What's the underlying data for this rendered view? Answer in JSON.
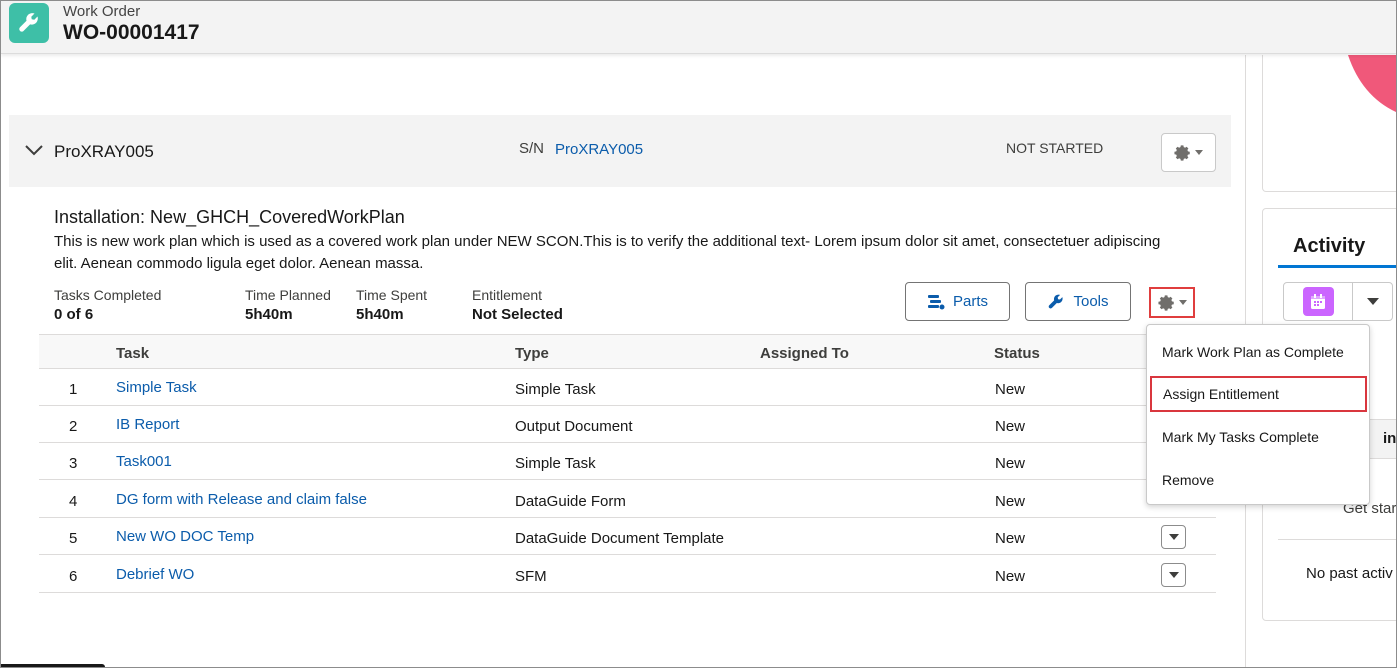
{
  "header": {
    "object_label": "Work Order",
    "record_name": "WO-00001417"
  },
  "asset": {
    "name": "ProXRAY005",
    "sn_label": "S/N",
    "sn_value": "ProXRAY005",
    "status": "NOT STARTED"
  },
  "plan": {
    "title": "Installation: New_GHCH_CoveredWorkPlan",
    "description": "This is new work plan which is used as a covered work plan under NEW SCON.This is to verify the additional text- Lorem ipsum dolor sit amet, consectetuer adipiscing elit. Aenean commodo ligula eget dolor. Aenean massa.",
    "stats": {
      "tasks_completed_label": "Tasks Completed",
      "tasks_completed_value": "0 of 6",
      "time_planned_label": "Time Planned",
      "time_planned_value": "5h40m",
      "time_spent_label": "Time Spent",
      "time_spent_value": "5h40m",
      "entitlement_label": "Entitlement",
      "entitlement_value": "Not Selected"
    },
    "buttons": {
      "parts": "Parts",
      "tools": "Tools"
    }
  },
  "table": {
    "headers": {
      "task": "Task",
      "type": "Type",
      "assigned_to": "Assigned To",
      "status": "Status"
    },
    "rows": [
      {
        "num": "1",
        "task": "Simple Task",
        "type": "Simple Task",
        "status": "New"
      },
      {
        "num": "2",
        "task": "IB Report",
        "type": "Output Document",
        "status": "New"
      },
      {
        "num": "3",
        "task": "Task001",
        "type": "Simple Task",
        "status": "New"
      },
      {
        "num": "4",
        "task": "DG form with Release and claim false",
        "type": "DataGuide Form",
        "status": "New"
      },
      {
        "num": "5",
        "task": "New WO DOC Temp",
        "type": "DataGuide Document Template",
        "status": "New"
      },
      {
        "num": "6",
        "task": "Debrief WO",
        "type": "SFM",
        "status": "New"
      }
    ]
  },
  "menu": {
    "items": [
      "Mark Work Plan as Complete",
      "Assign Entitlement",
      "Mark My Tasks Complete",
      "Remove"
    ],
    "highlighted": "Assign Entitlement"
  },
  "right_panel": {
    "activity_title": "Activity",
    "grey_text": "ing",
    "get_started": "Get star",
    "no_past": "No past activ"
  },
  "colors": {
    "accent_teal": "#3ebfa7",
    "link_blue": "#0b5cab",
    "highlight_red": "#d9363e",
    "calendar_purple": "#cb65ff",
    "chart_pink": "#f0587a"
  },
  "icons": {
    "app": "wrench-icon",
    "parts": "parts-list-icon",
    "tools": "wrench-icon",
    "settings": "gear-icon",
    "calendar": "calendar-icon"
  }
}
